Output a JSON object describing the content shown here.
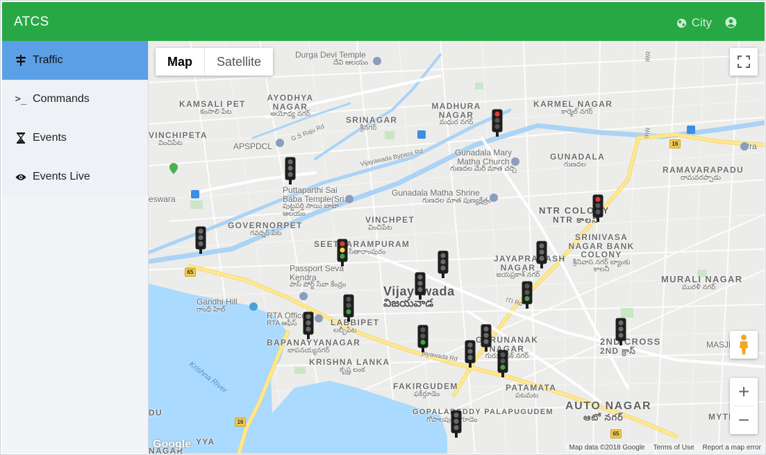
{
  "app": {
    "title": "ATCS",
    "city_label": "City"
  },
  "icons": {
    "city": "globe-icon",
    "user": "user-circle-icon",
    "fullscreen": "fullscreen-icon",
    "pegman": "pegman-icon"
  },
  "colors": {
    "appbar": "#28a745",
    "active_nav": "#5ba0e6",
    "water": "#aadaff",
    "highway": "#ffe88a"
  },
  "sidebar": {
    "items": [
      {
        "label": "Traffic",
        "icon": "signpost-icon",
        "active": true
      },
      {
        "label": "Commands",
        "icon": "terminal-icon",
        "active": false
      },
      {
        "label": "Events",
        "icon": "hourglass-icon",
        "active": false
      },
      {
        "label": "Events Live",
        "icon": "eye-icon",
        "active": false
      }
    ]
  },
  "map": {
    "type_buttons": {
      "map": "Map",
      "satellite": "Satellite",
      "selected": "Map"
    },
    "zoom_in": "+",
    "zoom_out": "−",
    "google_logo": "Google",
    "attribution": {
      "data": "Map data ©2018 Google",
      "terms": "Terms of Use",
      "report": "Report a map error"
    },
    "labels": {
      "durga": "Durga Devi Temple",
      "durga_te": "దేవి ఆలయం",
      "kamsali": "KAMSALI PET",
      "kamsali_te": "కంసాలి పేట",
      "ayodhya": "AYODHYA NAGAR",
      "ayodhya_te": "అయోధ్య నగర్",
      "srinagar": "SRINAGAR",
      "srinagar_te": "శ్రీనగర్",
      "madhura": "MADHURA NAGAR",
      "madhura_te": "మధుర నగర్",
      "karmel": "KARMEL NAGAR",
      "karmel_te": "కార్మెల్ నగర్",
      "vinchipeta_w": "VINCHIPETA",
      "vinchipeta_w_te": "వించిపేట",
      "apspdcl": "APSPDCL",
      "gs_raju": "G S Raju Rd",
      "bypass": "Vijayawada Bypass Rd",
      "gunadala_church": "Gunadala Mary Matha Church",
      "gunadala_church_te": "గుణదల మేరీ మాత చర్చి",
      "gunadala": "GUNADALA",
      "gunadala_te": "గుణదల",
      "ramavarapadu": "RAMAVARAPADU",
      "ramavarapadu_te": "రామవరప్పాడు",
      "puttaparthi": "Puttaparthi Sai Baba Temple(Sri...",
      "puttaparthi_te": "పుట్టపర్తి సాయి బాబా ఆలయం",
      "gunadala_shrine": "Gunadala Matha Shrine",
      "gunadala_shrine_te": "గుణదల మాత పుణ్యక్షేత్రం",
      "eswara": "eswara",
      "ntr": "NTR COLONY",
      "ntr_te": "NTR కాలనీ",
      "vinchpet": "VINCHPET",
      "vinchpet_te": "వించిపేట",
      "governorpet": "GOVERNORPET",
      "governorpet_te": "గవర్నర్ పేట",
      "srinivasa": "SRINIVASA NAGAR BANK COLONY",
      "srinivasa_te": "శ్రీనివాస నగర్ బ్యాంకు కాలనీ",
      "seetharampuram": "SEETHARAMPURAM",
      "seetharampuram_te": "సీతారాంపురం",
      "jayaprakash": "JAYAPRAKASH NAGAR",
      "jayaprakash_te": "జయప్రకాశ్ నగర్",
      "passport": "Passport Seva Kendra",
      "passport_te": "పాస్ పోర్ట్ సేవా కేంద్రం",
      "vijayawada": "Vijayawada",
      "vijayawada_te": "విజయవాడ",
      "murali": "MURALI NAGAR",
      "murali_te": "మురళీ నగర్",
      "gandhi_hill": "Gandhi Hill",
      "gandhi_hill_te": "గాంధీ హిల్",
      "rta": "RTA Office",
      "rta_te": "RTA ఆఫీస్",
      "iti": "ITI Rd",
      "labbipet": "LABBIPET",
      "labbipet_te": "లబ్బీపేట",
      "gurunanak": "GURUNANAK NAGAR",
      "gurunanak_te": "గురునానక్ నగర్",
      "cross2": "2ND CROSS",
      "cross2_te": "2ND క్రాస్",
      "masjid": "MASJID E",
      "bapanayya": "BAPANAYYANAGAR",
      "bapanayya_te": "బాపనయ్యనగర్",
      "krishna_lanka": "KRISHNA LANKA",
      "krishna_lanka_te": "కృష్ణ లంక",
      "jayawada_rd": "jayawada Rd",
      "krishna_river": "Krishna River",
      "fakirgudem": "FAKIRGUDEM",
      "fakirgudem_te": "ఫకీర్గూడెం",
      "patamata": "PATAMATA",
      "patamata_te": "పటమట",
      "auto_nagar": "AUTO NAGAR",
      "auto_nagar_te": "ఆటో నగర్",
      "mytr": "MYTR",
      "gopala": "GOPALAREDDY PALAPUGUDEM",
      "gopala_te": "గోపాలపురం గూడెం",
      "irr1": "IRR",
      "irr2": "IRR",
      "du": "DU",
      "yya": "YYA",
      "nagar_bl": "NAGAR",
      "pra": "Pra"
    },
    "road_numbers": [
      "16",
      "65",
      "16",
      "65"
    ],
    "signals": [
      {
        "name": "signal-1",
        "state": "red"
      },
      {
        "name": "signal-2",
        "state": "off"
      },
      {
        "name": "signal-3",
        "state": "off"
      },
      {
        "name": "signal-4",
        "state": "red-yellow-green"
      },
      {
        "name": "signal-5",
        "state": "red"
      },
      {
        "name": "signal-6",
        "state": "off"
      },
      {
        "name": "signal-7",
        "state": "off"
      },
      {
        "name": "signal-8",
        "state": "green"
      },
      {
        "name": "signal-9",
        "state": "off"
      },
      {
        "name": "signal-10",
        "state": "green"
      },
      {
        "name": "signal-11",
        "state": "off"
      },
      {
        "name": "signal-12",
        "state": "green"
      },
      {
        "name": "signal-13",
        "state": "off"
      },
      {
        "name": "signal-14",
        "state": "off"
      },
      {
        "name": "signal-15",
        "state": "off"
      },
      {
        "name": "signal-16",
        "state": "green"
      },
      {
        "name": "signal-17",
        "state": "off"
      }
    ]
  }
}
